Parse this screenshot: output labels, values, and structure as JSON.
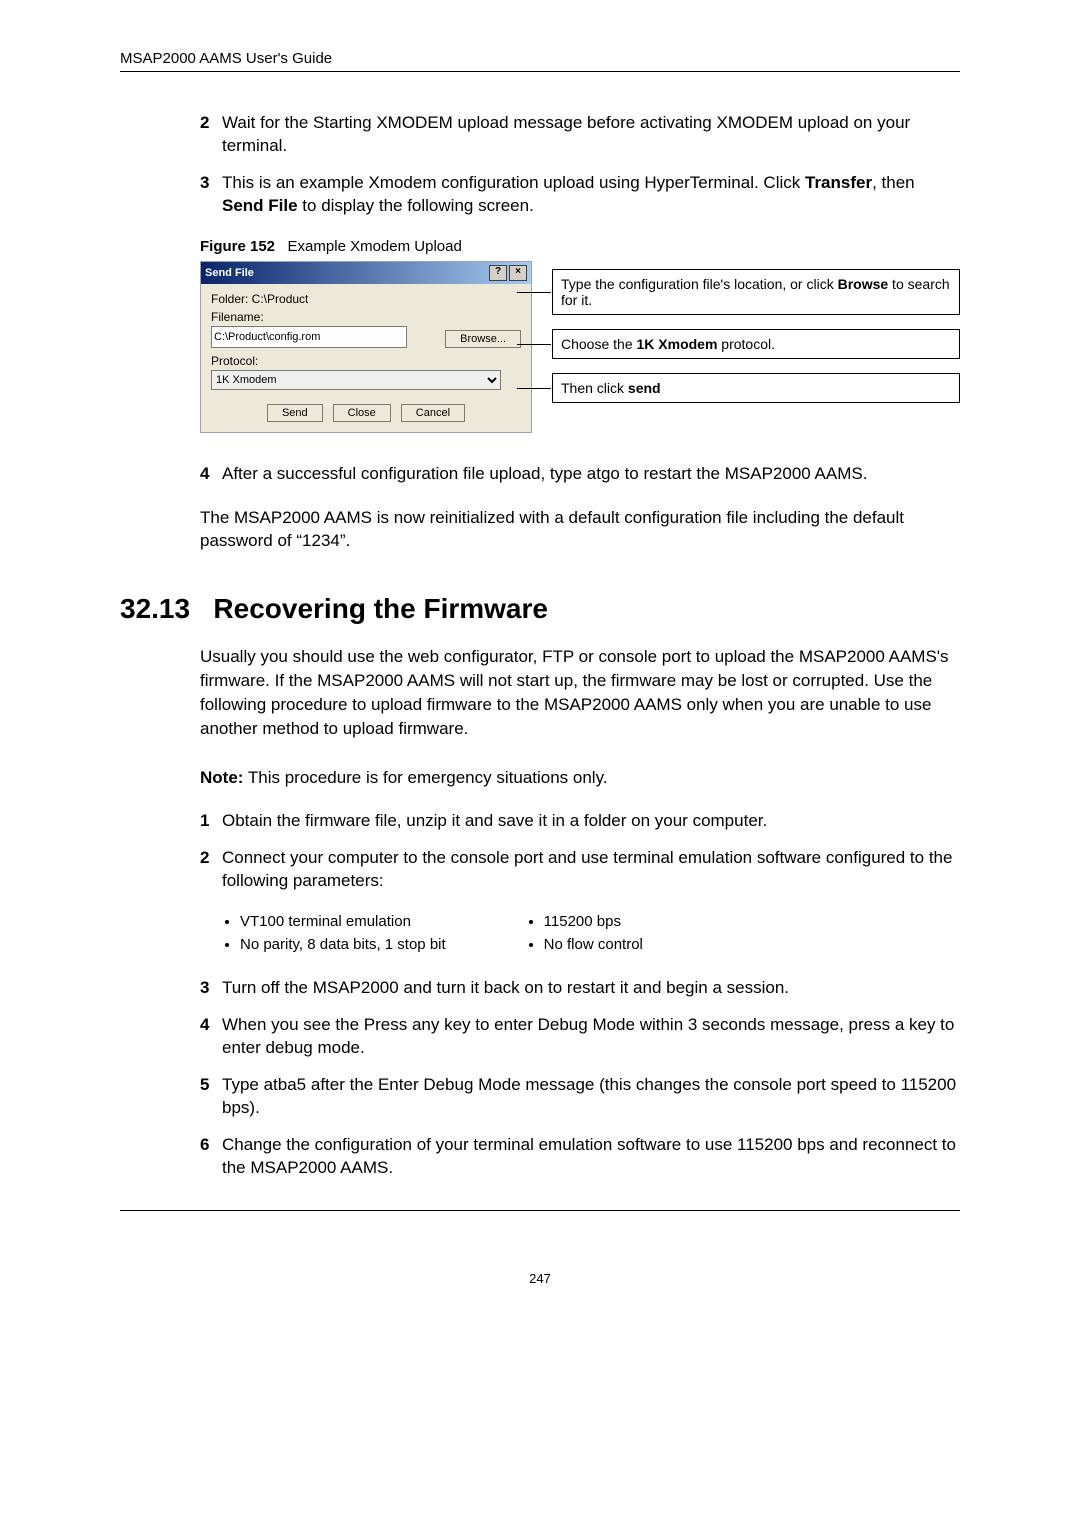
{
  "header": {
    "title": "MSAP2000 AAMS User's Guide"
  },
  "steps_a": [
    {
      "n": "2",
      "text": "Wait for the Starting XMODEM upload message before activating XMODEM upload on your terminal."
    },
    {
      "n": "3",
      "text_pre": "This is an example Xmodem configuration upload using HyperTerminal. Click ",
      "bold1": "Transfer",
      "mid": ", then ",
      "bold2": "Send File",
      "post": " to display the following screen."
    }
  ],
  "figure": {
    "label": "Figure 152",
    "caption": "Example Xmodem Upload"
  },
  "dialog": {
    "title": "Send File",
    "folder_label": "Folder: C:\\Product",
    "filename_label": "Filename:",
    "filename_value": "C:\\Product\\config.rom",
    "browse": "Browse...",
    "protocol_label": "Protocol:",
    "protocol_value": "1K Xmodem",
    "send": "Send",
    "close": "Close",
    "cancel": "Cancel"
  },
  "annot": {
    "a1_pre": "Type the configuration file's location, or click ",
    "a1_bold": "Browse",
    "a1_post": " to search for it.",
    "a2_pre": "Choose the ",
    "a2_bold": "1K Xmodem",
    "a2_post": " protocol.",
    "a3_pre": "Then click ",
    "a3_bold": "send"
  },
  "step4": {
    "n": "4",
    "text": "After a successful configuration file upload, type atgo to restart the MSAP2000 AAMS."
  },
  "after_step4": "The MSAP2000 AAMS is now reinitialized with a default configuration file including the default password of “1234”.",
  "section": {
    "num": "32.13",
    "title": "Recovering the Firmware"
  },
  "para1": "Usually you should use the web configurator, FTP or console port to upload the MSAP2000 AAMS's firmware. If the MSAP2000 AAMS will not start up, the firmware may be lost or corrupted. Use the following procedure to upload firmware to the MSAP2000 AAMS only when you are unable to use another method to upload firmware.",
  "note_bold": "Note:",
  "note_text": " This procedure is for emergency situations only.",
  "steps_b": [
    {
      "n": "1",
      "html": "Obtain the firmware file, unzip it and save it in a folder on your computer."
    },
    {
      "n": "2",
      "html": "Connect your computer to the console port and use terminal emulation software configured to the following parameters:"
    }
  ],
  "params_left": [
    "VT100 terminal emulation",
    "No parity, 8 data bits, 1 stop bit"
  ],
  "params_right": [
    "115200 bps",
    "No flow control"
  ],
  "steps_c": [
    {
      "n": "3",
      "text": "Turn off the MSAP2000 and turn it back on to restart it and begin a session."
    },
    {
      "n": "4",
      "text_pre": "When you see the ",
      "mono": "Press any key to enter Debug Mode within 3 seconds",
      "post": " message, press a key to enter debug mode."
    },
    {
      "n": "5",
      "text_pre": "Type ",
      "mono1": "atba5",
      "mid": " after the ",
      "mono2": "Enter Debug Mode",
      "post": " message (this changes the console port speed to 115200 bps)."
    },
    {
      "n": "6",
      "text": "Change the configuration of your terminal emulation software to use 115200 bps and reconnect to the MSAP2000 AAMS."
    }
  ],
  "page_number": "247"
}
